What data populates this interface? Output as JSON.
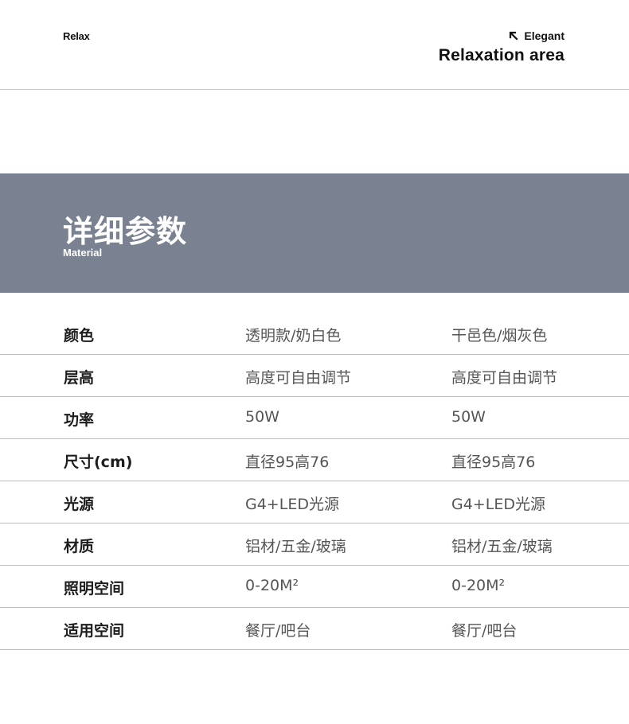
{
  "header": {
    "brand_left": "Relax",
    "tag": "Elegant",
    "title": "Relaxation area"
  },
  "banner": {
    "title": "详细参数",
    "subtitle": "Material",
    "background": "#7a8292"
  },
  "specs": [
    {
      "label": "颜色",
      "value_a": "透明款/奶白色",
      "value_b": "干邑色/烟灰色"
    },
    {
      "label": "层高",
      "value_a": "高度可自由调节",
      "value_b": "高度可自由调节"
    },
    {
      "label": "功率",
      "value_a": "50W",
      "value_b": "50W"
    },
    {
      "label": "尺寸(cm)",
      "value_a": "直径95高76",
      "value_b": "直径95高76"
    },
    {
      "label": "光源",
      "value_a": "G4+LED光源",
      "value_b": "G4+LED光源"
    },
    {
      "label": "材质",
      "value_a": "铝材/五金/玻璃",
      "value_b": "铝材/五金/玻璃"
    },
    {
      "label": "照明空间",
      "value_a": "0-20M²",
      "value_b": "0-20M²"
    },
    {
      "label": "适用空间",
      "value_a": "餐厅/吧台",
      "value_b": "餐厅/吧台"
    }
  ],
  "icons": {
    "arrow": "arrow-up-left-icon"
  }
}
